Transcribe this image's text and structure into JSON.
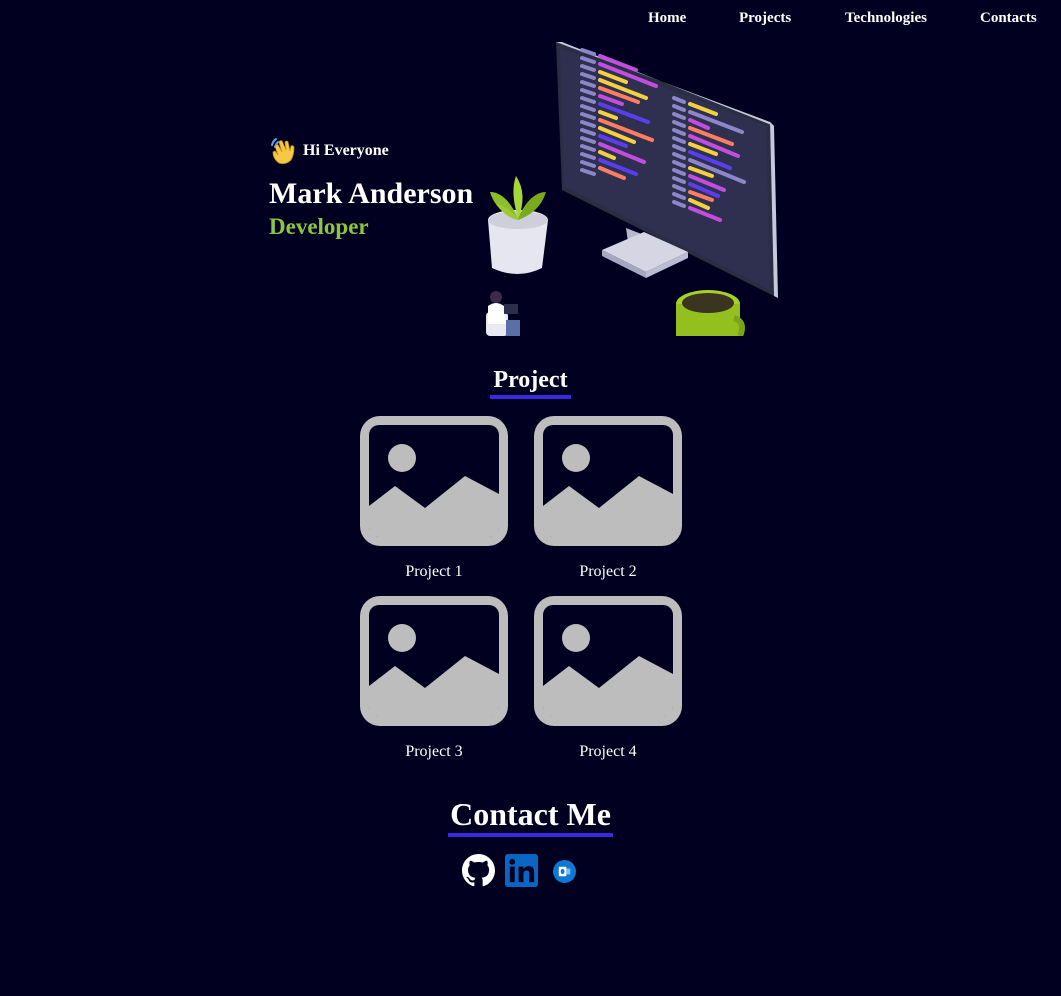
{
  "nav": {
    "items": [
      "Home",
      "Projects",
      "Technologies",
      "Contacts"
    ]
  },
  "hero": {
    "greeting": "Hi Everyone",
    "name": "Mark Anderson",
    "role": "Developer",
    "accent_color": "#8cc63f"
  },
  "projects_section": {
    "title": "Project",
    "items": [
      {
        "label": "Project 1",
        "icon": "image-placeholder-icon"
      },
      {
        "label": "Project 2",
        "icon": "image-placeholder-icon"
      },
      {
        "label": "Project 3",
        "icon": "image-placeholder-icon"
      },
      {
        "label": "Project 4",
        "icon": "image-placeholder-icon"
      }
    ]
  },
  "contact_section": {
    "title": "Contact Me",
    "links": [
      {
        "icon": "github-icon"
      },
      {
        "icon": "linkedin-icon"
      },
      {
        "icon": "outlook-icon"
      }
    ]
  },
  "colors": {
    "background": "#020020",
    "underline": "#3b28e0",
    "placeholder": "#bdbdbd"
  }
}
